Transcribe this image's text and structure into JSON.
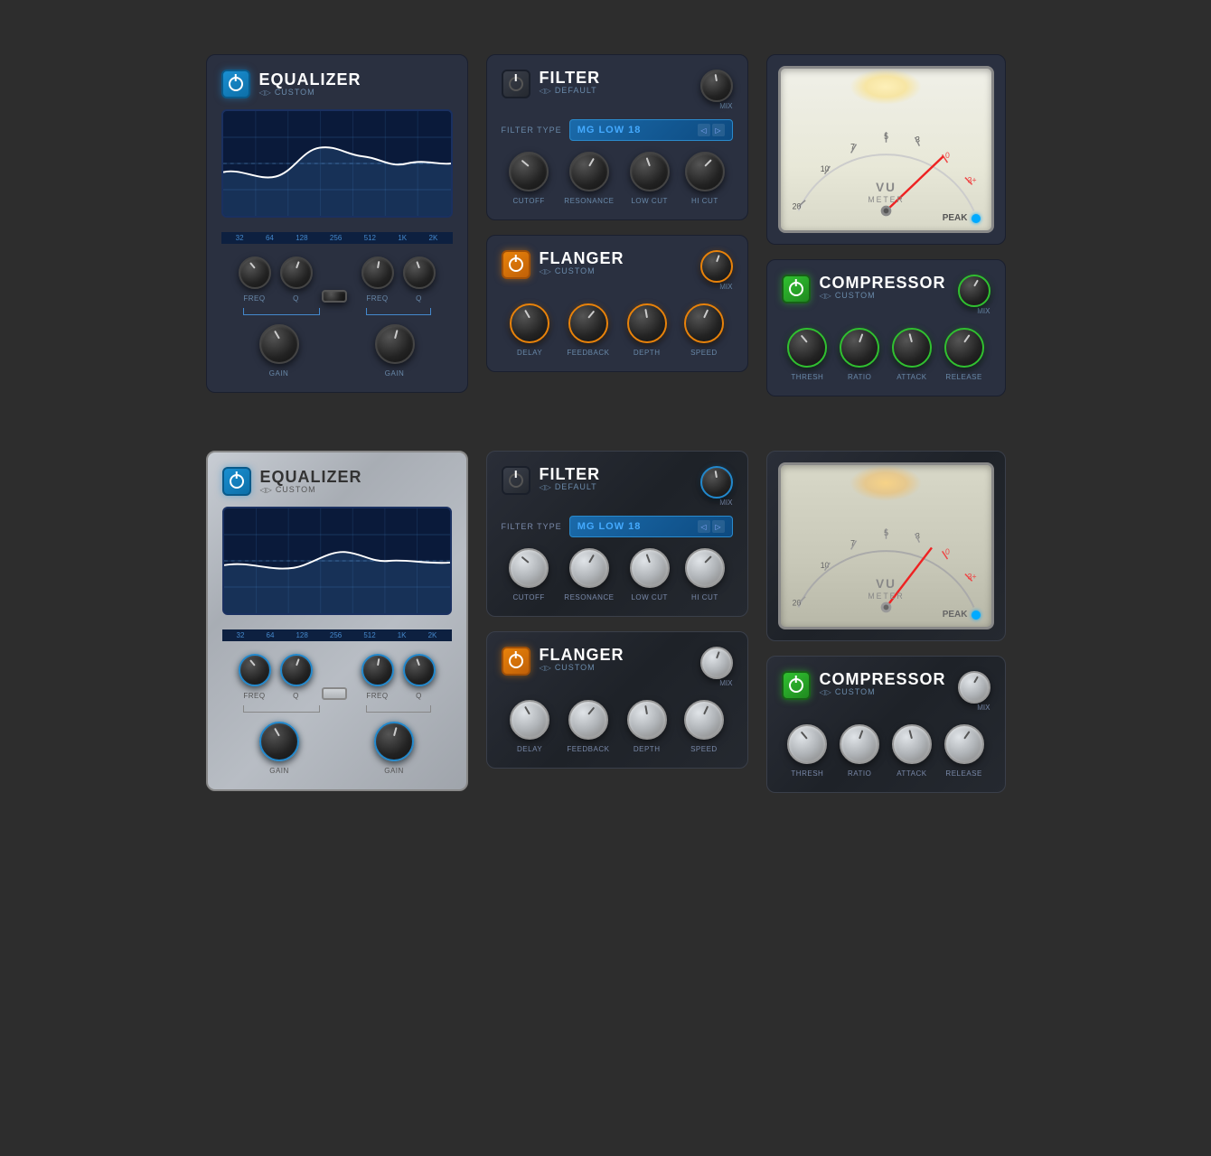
{
  "theme": {
    "bg": "#2d2d2d"
  },
  "row1": {
    "equalizer": {
      "title": "EQUALIZER",
      "subtitle": "CUSTOM",
      "freq_labels": [
        "32",
        "64",
        "128",
        "256",
        "512",
        "1K",
        "2K"
      ],
      "knobs": {
        "freq1_label": "FREQ",
        "q1_label": "Q",
        "freq2_label": "FREQ",
        "q2_label": "Q",
        "gain1_label": "GAIN",
        "gain2_label": "GAIN"
      }
    },
    "filter": {
      "title": "FILTER",
      "subtitle": "DEFAULT",
      "mix_label": "MIX",
      "filter_type_label": "FILTER TYPE",
      "filter_type_value": "MG LOW 18",
      "knobs": {
        "cutoff": "CUTOFF",
        "resonance": "RESONANCE",
        "low_cut": "LOW CUT",
        "hi_cut": "HI CUT"
      }
    },
    "vu": {
      "title": "VU",
      "subtitle": "METER",
      "peak_label": "PEAK",
      "scale": [
        "20",
        "10",
        "7",
        "5",
        "3",
        "0",
        "3+"
      ]
    },
    "flanger": {
      "title": "FLANGER",
      "subtitle": "CUSTOM",
      "mix_label": "MIX",
      "knobs": {
        "delay": "DELAY",
        "feedback": "FEEDBACK",
        "depth": "DEPTH",
        "speed": "SPEED"
      }
    },
    "compressor": {
      "title": "COMPRESSOR",
      "subtitle": "CUSTOM",
      "mix_label": "MIX",
      "knobs": {
        "thresh": "THRESH",
        "ratio": "RATIO",
        "attack": "ATTACK",
        "release": "RELEASE"
      }
    }
  },
  "row2": {
    "equalizer": {
      "title": "EQUALIZER",
      "subtitle": "CUSTOM",
      "freq_labels": [
        "32",
        "64",
        "128",
        "256",
        "512",
        "1K",
        "2K"
      ],
      "knobs": {
        "freq1_label": "FREQ",
        "q1_label": "Q",
        "freq2_label": "FREQ",
        "q2_label": "Q",
        "gain1_label": "GAIN",
        "gain2_label": "GAIN"
      }
    },
    "filter": {
      "title": "FILTER",
      "subtitle": "DEFAULT",
      "mix_label": "MIX",
      "filter_type_label": "FILTER TYPE",
      "filter_type_value": "MG LOW 18",
      "knobs": {
        "cutoff": "CUTOFF",
        "resonance": "RESONANCE",
        "low_cut": "LOW CUT",
        "hi_cut": "HI CUT"
      }
    },
    "vu": {
      "title": "VU",
      "subtitle": "METER",
      "peak_label": "PEAK",
      "scale": [
        "20",
        "10",
        "7",
        "5",
        "3",
        "0",
        "3+"
      ]
    },
    "flanger": {
      "title": "FLANGER",
      "subtitle": "CUSTOM",
      "mix_label": "MIX",
      "knobs": {
        "delay": "DELAY",
        "feedback": "FEEDBACK",
        "depth": "DEPTH",
        "speed": "SPEED"
      }
    },
    "compressor": {
      "title": "COMPRESSOR",
      "subtitle": "CUSTOM",
      "mix_label": "MIX",
      "knobs": {
        "thresh": "THRESH",
        "ratio": "RATIO",
        "attack": "ATTACK",
        "release": "RELEASE"
      }
    }
  }
}
